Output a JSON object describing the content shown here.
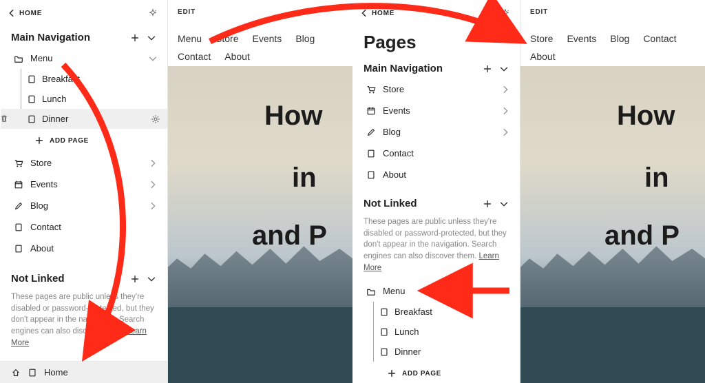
{
  "home_crumb": "HOME",
  "sparkle": "✦",
  "edit_label": "EDIT",
  "pages_title": "Pages",
  "sections": {
    "main_nav": "Main Navigation",
    "not_linked": "Not Linked"
  },
  "add_page": "ADD PAGE",
  "not_linked_help": "These pages are public unless they're disabled or password-protected, but they don't appear in the navigation. Search engines can also discover them.",
  "learn_more": "Learn More",
  "left_panel": {
    "menu": {
      "label": "Menu",
      "children": [
        "Breakfast",
        "Lunch",
        "Dinner"
      ]
    },
    "items": [
      {
        "label": "Store",
        "icon": "cart"
      },
      {
        "label": "Events",
        "icon": "calendar"
      },
      {
        "label": "Blog",
        "icon": "pencil"
      },
      {
        "label": "Contact",
        "icon": "page"
      },
      {
        "label": "About",
        "icon": "page"
      }
    ],
    "home_row": "Home"
  },
  "right_panel": {
    "items": [
      {
        "label": "Store",
        "icon": "cart"
      },
      {
        "label": "Events",
        "icon": "calendar"
      },
      {
        "label": "Blog",
        "icon": "pencil"
      },
      {
        "label": "Contact",
        "icon": "page"
      },
      {
        "label": "About",
        "icon": "page"
      }
    ],
    "menu": {
      "label": "Menu",
      "children": [
        "Breakfast",
        "Lunch",
        "Dinner"
      ]
    }
  },
  "site_nav_left": [
    "Menu",
    "Store",
    "Events",
    "Blog",
    "Contact",
    "About"
  ],
  "site_nav_right": [
    "Store",
    "Events",
    "Blog",
    "Contact",
    "About"
  ],
  "hero_lines": {
    "l1": "How",
    "l2": "in",
    "l3": "and P"
  },
  "hero_lines_right": {
    "l1": "How",
    "l2": "in",
    "l3": "and P"
  }
}
